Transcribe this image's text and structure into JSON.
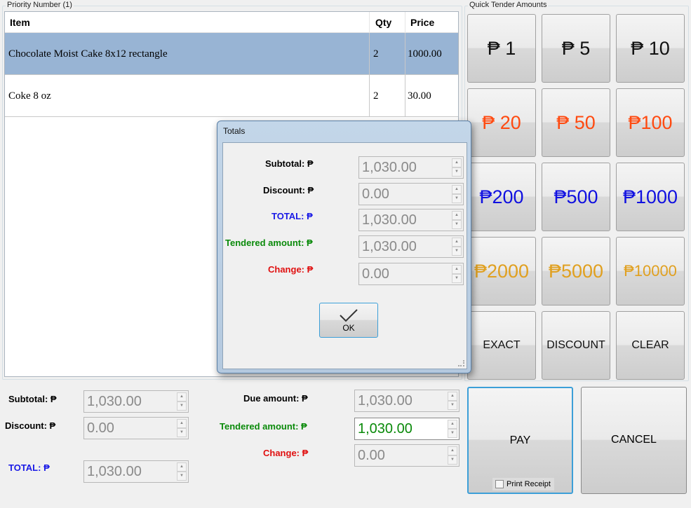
{
  "order": {
    "group_title": "Priority Number (1)",
    "columns": {
      "item": "Item",
      "qty": "Qty",
      "price": "Price"
    },
    "rows": [
      {
        "item": "Chocolate Moist Cake 8x12 rectangle",
        "qty": "2",
        "price": "1000.00",
        "selected": true
      },
      {
        "item": "Coke 8 oz",
        "qty": "2",
        "price": "30.00",
        "selected": false
      }
    ]
  },
  "quick_tender": {
    "group_title": "Quick Tender Amounts",
    "buttons": [
      {
        "label": "₱ 1",
        "color": "#111111"
      },
      {
        "label": "₱ 5",
        "color": "#111111"
      },
      {
        "label": "₱ 10",
        "color": "#111111"
      },
      {
        "label": "₱ 20",
        "color": "#ff4a10"
      },
      {
        "label": "₱ 50",
        "color": "#ff4a10"
      },
      {
        "label": "₱100",
        "color": "#ff4a10"
      },
      {
        "label": "₱200",
        "color": "#1010e0"
      },
      {
        "label": "₱500",
        "color": "#1010e0"
      },
      {
        "label": "₱1000",
        "color": "#1010e0"
      },
      {
        "label": "₱2000",
        "color": "#e0a020"
      },
      {
        "label": "₱5000",
        "color": "#e0a020"
      },
      {
        "label": "₱10000",
        "color": "#e0a020"
      },
      {
        "label": "EXACT"
      },
      {
        "label": "DISCOUNT"
      },
      {
        "label": "CLEAR"
      }
    ]
  },
  "actions": {
    "pay": "PAY",
    "print_receipt": "Print Receipt",
    "cancel": "CANCEL"
  },
  "summary": {
    "subtotal_label": "Subtotal: ₱",
    "subtotal_value": "1,030.00",
    "discount_label": "Discount: ₱",
    "discount_value": "0.00",
    "total_label": "TOTAL: ₱",
    "total_value": "1,030.00",
    "due_label": "Due amount: ₱",
    "due_value": "1,030.00",
    "tendered_label": "Tendered amount: ₱",
    "tendered_value": "1,030.00",
    "change_label": "Change: ₱",
    "change_value": "0.00"
  },
  "dialog": {
    "title": "Totals",
    "subtotal_label": "Subtotal: ₱",
    "subtotal_value": "1,030.00",
    "discount_label": "Discount: ₱",
    "discount_value": "0.00",
    "total_label": "TOTAL: ₱",
    "total_value": "1,030.00",
    "tendered_label": "Tendered amount: ₱",
    "tendered_value": "1,030.00",
    "change_label": "Change: ₱",
    "change_value": "0.00",
    "ok": "OK"
  },
  "colors": {
    "selected_row": "#98b4d4",
    "total_blue": "#1a1ae6",
    "tendered_green": "#0a8a0a",
    "change_red": "#e01010",
    "focus_border": "#3c9fd8"
  }
}
